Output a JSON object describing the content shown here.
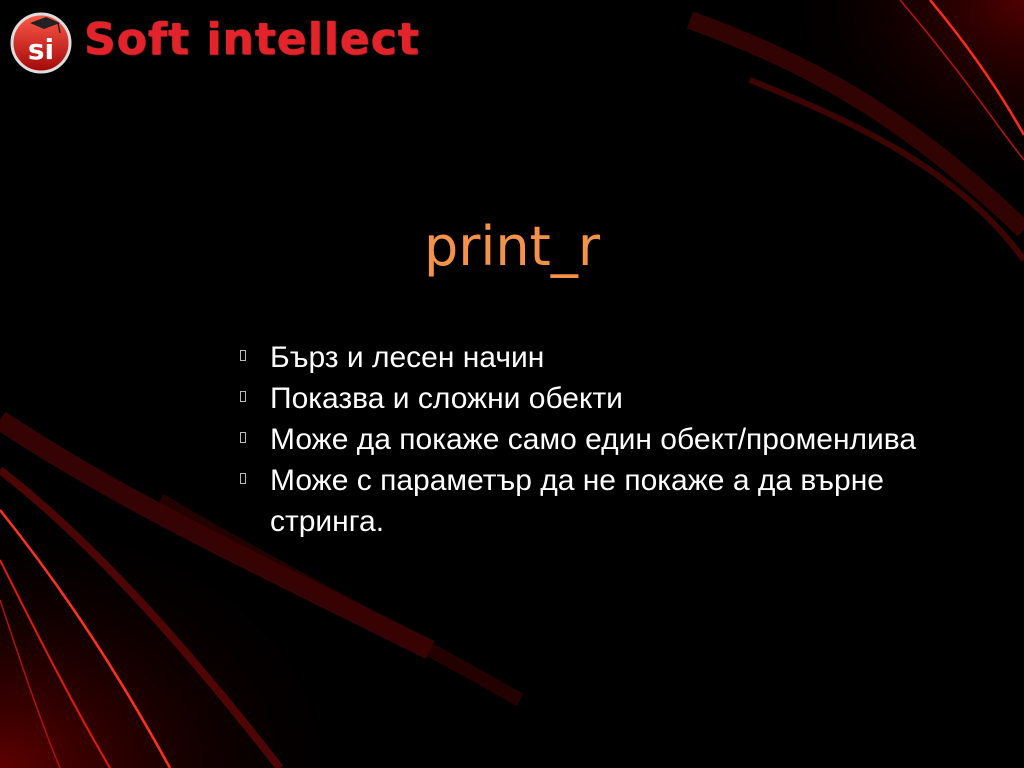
{
  "logo": {
    "badge_text": "si",
    "brand_text": "Soft intellect"
  },
  "slide": {
    "title": "print_r",
    "bullets": [
      "Бърз и лесен начин",
      "Показва и сложни обекти",
      "Може да покаже само един обект/променлива",
      "Може с параметър да не покаже а да върне стринга."
    ]
  },
  "colors": {
    "background": "#000000",
    "title": "#f4924a",
    "text": "#ffffff",
    "brand_red": "#e3222a"
  }
}
